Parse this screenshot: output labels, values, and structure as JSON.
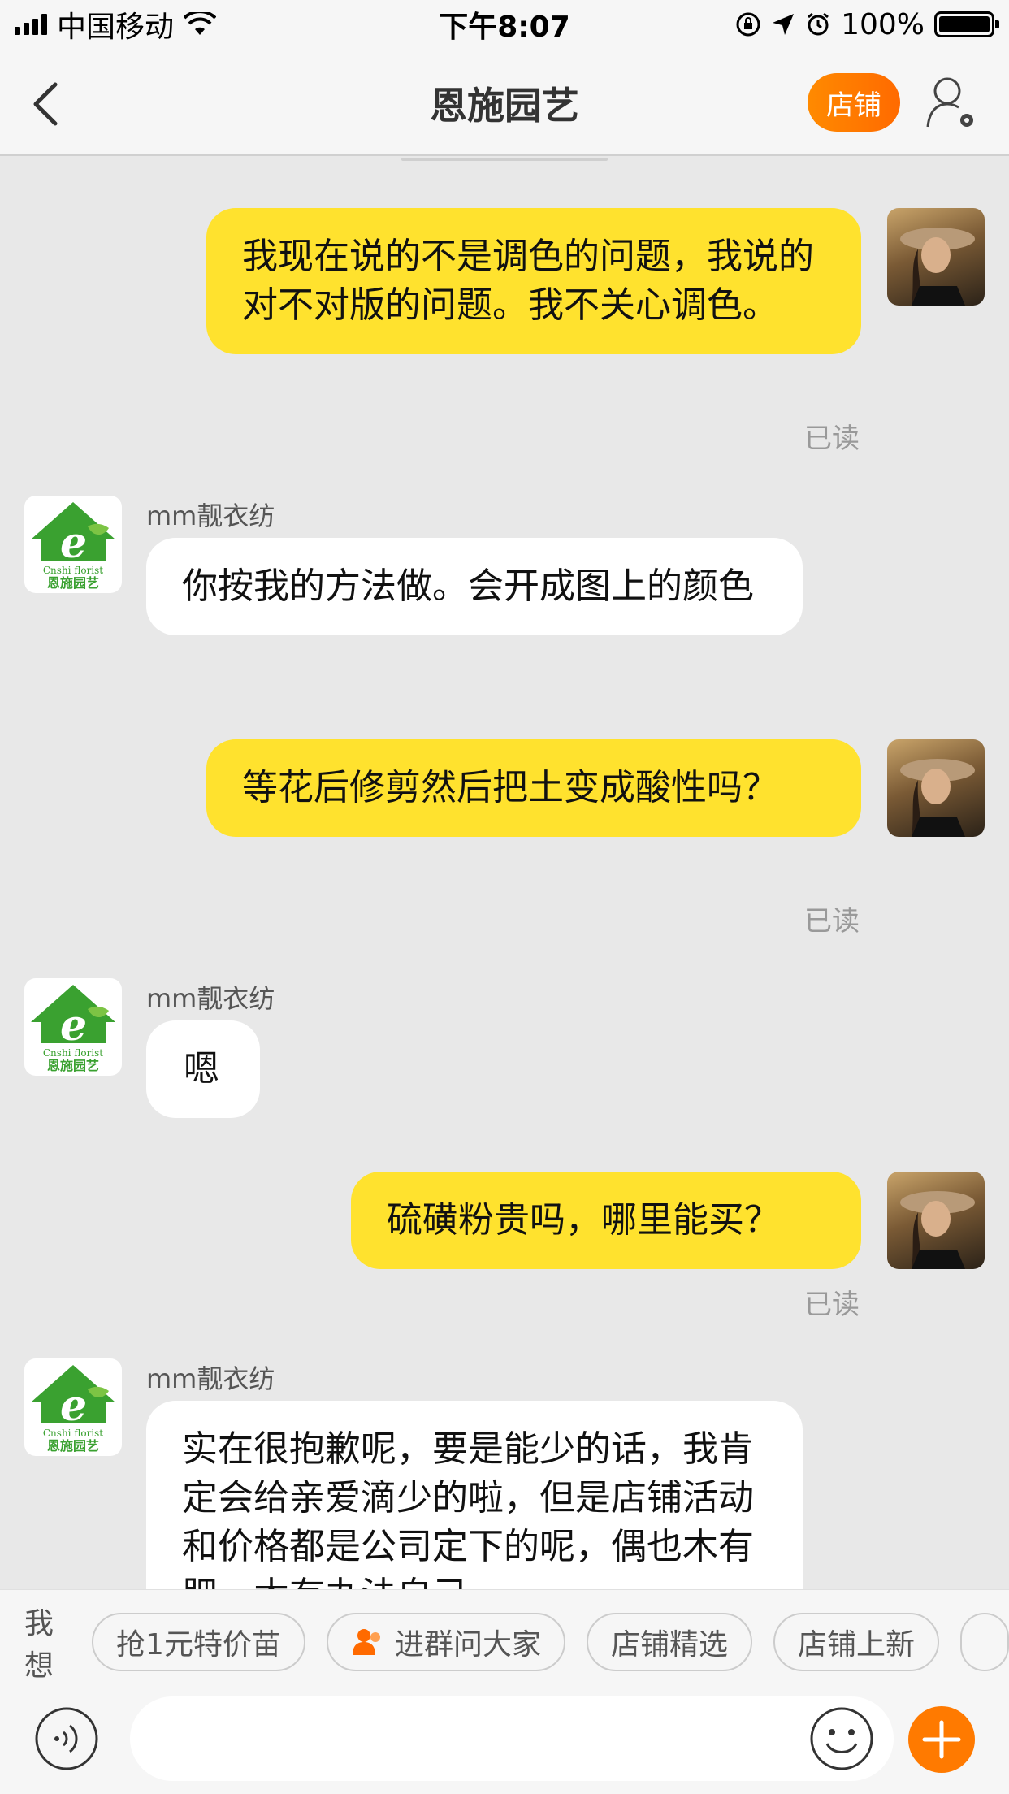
{
  "status_bar": {
    "carrier": "中国移动",
    "time": "下午8:07",
    "battery": "100%"
  },
  "nav": {
    "title": "恩施园艺",
    "shop_button": "店铺"
  },
  "messages": [
    {
      "from": "me",
      "text": "我现在说的不是调色的问题，我说的对不对版的问题。我不关心调色。",
      "read": "已读"
    },
    {
      "from": "shop",
      "sender": "mm靓衣纺",
      "text": "你按我的方法做。会开成图上的颜色"
    },
    {
      "from": "me",
      "text": "等花后修剪然后把土变成酸性吗？",
      "read": "已读"
    },
    {
      "from": "shop",
      "sender": "mm靓衣纺",
      "text": "嗯"
    },
    {
      "from": "me",
      "text": "硫磺粉贵吗，哪里能买？",
      "read": "已读"
    },
    {
      "from": "shop",
      "sender": "mm靓衣纺",
      "text": "实在很抱歉呢，要是能少的话，我肯定会给亲爱滴少的啦，但是店铺活动和价格都是公司定下的呢，偶也木有肥，木有办法自己"
    }
  ],
  "shop_avatar": {
    "logo_letter": "e",
    "brand_en": "Cnshi florist",
    "brand_cn": "恩施园艺"
  },
  "quick_bar": {
    "label": "我想",
    "chips": [
      "抢1元特价苗",
      "进群问大家",
      "店铺精选",
      "店铺上新"
    ]
  },
  "colors": {
    "my_bubble": "#ffe22e",
    "shop_bubble": "#ffffff",
    "accent": "#ff7a00",
    "shop_green": "#3aa130"
  }
}
